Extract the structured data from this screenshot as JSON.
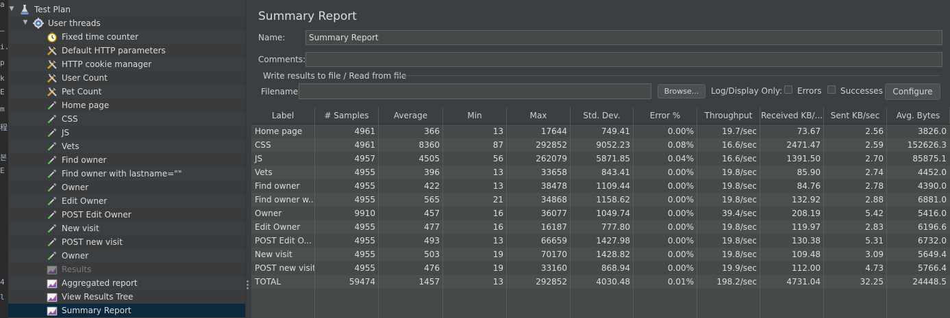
{
  "left_edge_glyphs": [
    "a",
    "–",
    "i.",
    "p",
    "k",
    "E",
    "m",
    "程",
    "본",
    "E",
    "4",
    "l"
  ],
  "tree": {
    "items": [
      {
        "label": "Test Plan",
        "icon": "flask-icon",
        "level": 0,
        "expanded": true
      },
      {
        "label": "User threads",
        "icon": "gear-icon",
        "level": 1,
        "expanded": true
      },
      {
        "label": "Fixed time counter",
        "icon": "timer-icon",
        "level": 2
      },
      {
        "label": "Default HTTP parameters",
        "icon": "wrench-icon",
        "level": 2
      },
      {
        "label": "HTTP cookie manager",
        "icon": "wrench-icon",
        "level": 2
      },
      {
        "label": "User Count",
        "icon": "wrench-icon",
        "level": 2
      },
      {
        "label": "Pet Count",
        "icon": "wrench-icon",
        "level": 2
      },
      {
        "label": "Home page",
        "icon": "pipette-icon",
        "level": 2
      },
      {
        "label": "CSS",
        "icon": "pipette-icon",
        "level": 2
      },
      {
        "label": "JS",
        "icon": "pipette-icon",
        "level": 2
      },
      {
        "label": "Vets",
        "icon": "pipette-icon",
        "level": 2
      },
      {
        "label": "Find owner",
        "icon": "pipette-icon",
        "level": 2
      },
      {
        "label": "Find owner with lastname=\"\"",
        "icon": "pipette-icon",
        "level": 2
      },
      {
        "label": "Owner",
        "icon": "pipette-icon",
        "level": 2
      },
      {
        "label": "Edit Owner",
        "icon": "pipette-icon",
        "level": 2
      },
      {
        "label": "POST Edit Owner",
        "icon": "pipette-icon",
        "level": 2
      },
      {
        "label": "New visit",
        "icon": "pipette-icon",
        "level": 2
      },
      {
        "label": "POST new visit",
        "icon": "pipette-icon",
        "level": 2
      },
      {
        "label": "Owner",
        "icon": "pipette-icon",
        "level": 2
      },
      {
        "label": "Results",
        "icon": "chart-icon",
        "level": 2,
        "disabled": true
      },
      {
        "label": "Aggregated report",
        "icon": "chart-icon",
        "level": 2
      },
      {
        "label": "View Results Tree",
        "icon": "chart-icon",
        "level": 2
      },
      {
        "label": "Summary Report",
        "icon": "chart-icon",
        "level": 2,
        "selected": true
      }
    ]
  },
  "panel": {
    "title": "Summary Report",
    "name_label": "Name:",
    "name_value": "Summary Report",
    "comments_label": "Comments:",
    "comments_value": "",
    "section_title": "Write results to file / Read from file",
    "filename_label": "Filename",
    "filename_value": "",
    "browse_label": "Browse...",
    "log_display_label": "Log/Display Only:",
    "errors_label": "Errors",
    "successes_label": "Successes",
    "configure_label": "Configure"
  },
  "table": {
    "columns": [
      "Label",
      "# Samples",
      "Average",
      "Min",
      "Max",
      "Std. Dev.",
      "Error %",
      "Throughput",
      "Received KB/...",
      "Sent KB/sec",
      "Avg. Bytes"
    ],
    "rows": [
      [
        "Home page",
        "4961",
        "366",
        "13",
        "17644",
        "749.41",
        "0.00%",
        "19.7/sec",
        "73.67",
        "2.56",
        "3826.0"
      ],
      [
        "CSS",
        "4961",
        "8360",
        "87",
        "292852",
        "9052.23",
        "0.08%",
        "16.6/sec",
        "2471.47",
        "2.59",
        "152626.3"
      ],
      [
        "JS",
        "4957",
        "4505",
        "56",
        "262079",
        "5871.85",
        "0.04%",
        "16.6/sec",
        "1391.50",
        "2.70",
        "85875.1"
      ],
      [
        "Vets",
        "4955",
        "396",
        "13",
        "33658",
        "843.41",
        "0.00%",
        "19.8/sec",
        "85.90",
        "2.74",
        "4452.0"
      ],
      [
        "Find owner",
        "4955",
        "422",
        "13",
        "38478",
        "1109.44",
        "0.00%",
        "19.8/sec",
        "84.76",
        "2.78",
        "4390.0"
      ],
      [
        "Find owner w...",
        "4955",
        "565",
        "21",
        "34868",
        "1158.62",
        "0.00%",
        "19.8/sec",
        "132.92",
        "2.88",
        "6881.0"
      ],
      [
        "Owner",
        "9910",
        "457",
        "16",
        "36077",
        "1049.74",
        "0.00%",
        "39.4/sec",
        "208.19",
        "5.42",
        "5416.0"
      ],
      [
        "Edit Owner",
        "4955",
        "477",
        "16",
        "16187",
        "777.80",
        "0.00%",
        "19.8/sec",
        "119.97",
        "2.83",
        "6196.6"
      ],
      [
        "POST Edit O...",
        "4955",
        "493",
        "13",
        "66659",
        "1427.98",
        "0.00%",
        "19.8/sec",
        "130.38",
        "5.31",
        "6732.0"
      ],
      [
        "New visit",
        "4955",
        "503",
        "19",
        "70170",
        "1428.82",
        "0.00%",
        "19.8/sec",
        "109.48",
        "3.09",
        "5649.4"
      ],
      [
        "POST new visit",
        "4955",
        "476",
        "19",
        "33160",
        "868.94",
        "0.00%",
        "19.9/sec",
        "112.00",
        "4.73",
        "5766.4"
      ],
      [
        "TOTAL",
        "59474",
        "1457",
        "13",
        "292852",
        "4030.48",
        "0.01%",
        "198.2/sec",
        "4731.04",
        "32.25",
        "24448.5"
      ]
    ]
  },
  "colors": {
    "background": "#3c3f41",
    "selected_row": "#0d293e",
    "table_bg": "#45494a",
    "text": "#dedede"
  }
}
